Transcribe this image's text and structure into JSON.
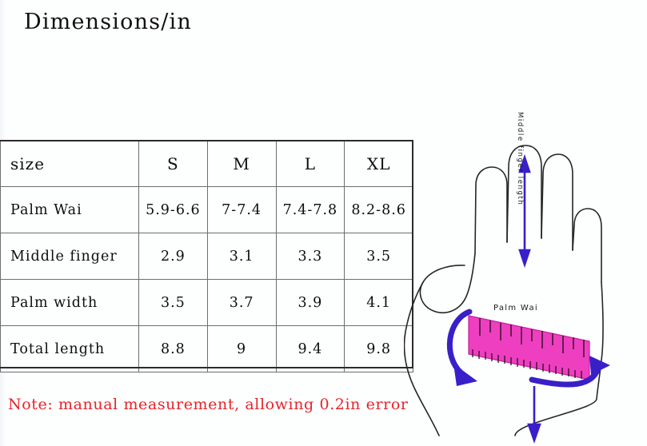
{
  "page": {
    "title": "Dimensions/in",
    "background_color": "#fdfefe",
    "note": "Note: manual measurement, allowing 0.2in error",
    "note_color": "#e8232a"
  },
  "table": {
    "columns": [
      "size",
      "S",
      "M",
      "L",
      "XL"
    ],
    "rows": [
      {
        "label": "Palm Wai",
        "values": [
          "5.9-6.6",
          "7-7.4",
          "7.4-7.8",
          "8.2-8.6"
        ]
      },
      {
        "label": "Middle finger",
        "values": [
          "2.9",
          "3.1",
          "3.3",
          "3.5"
        ]
      },
      {
        "label": "Palm width",
        "values": [
          "3.5",
          "3.7",
          "3.9",
          "4.1"
        ]
      },
      {
        "label": "Total length",
        "values": [
          "8.8",
          "9",
          "9.4",
          "9.8"
        ]
      }
    ],
    "border_color": "#6e6e6e",
    "frame_color": "#2b2b2b"
  },
  "diagram": {
    "middle_finger_label": "Middle finger length",
    "palm_label": "Palm Wai",
    "hand_outline_color": "#262626",
    "arrow_color": "#3a1fc8",
    "tape_color": "#ee3fc0",
    "tape_edge_color": "#c61f9c"
  }
}
